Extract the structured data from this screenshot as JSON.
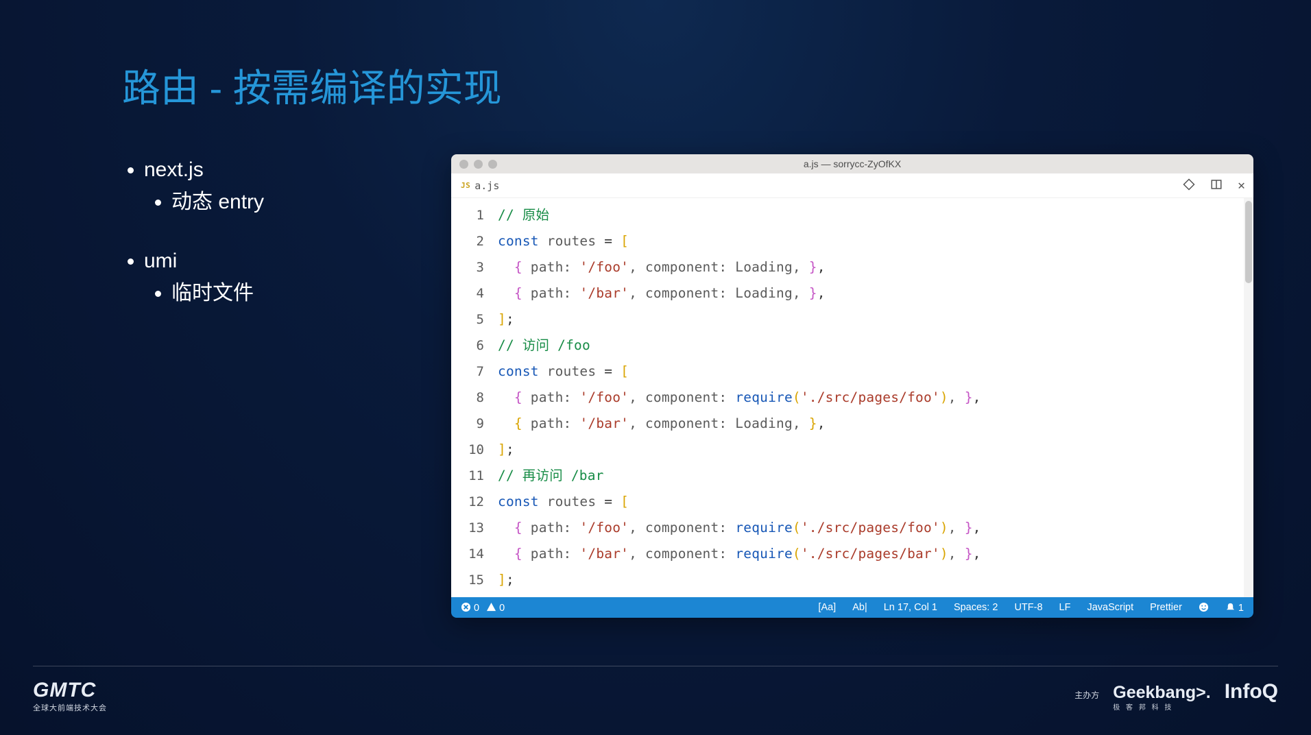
{
  "title": "路由 - 按需编译的实现",
  "bullets": {
    "items": [
      {
        "label": "next.js",
        "children": [
          {
            "label": "动态 entry"
          }
        ]
      },
      {
        "label": "umi",
        "children": [
          {
            "label": "临时文件"
          }
        ]
      }
    ]
  },
  "editor": {
    "window_title": "a.js — sorrycc-ZyOfKX",
    "tab": {
      "badge": "JS",
      "filename": "a.js"
    },
    "icons": {
      "git": "git-compare-icon",
      "layout": "layout-panels-icon",
      "close": "close-icon"
    },
    "code_lines": [
      [
        {
          "t": "// 原始",
          "c": "c-comment"
        }
      ],
      [
        {
          "t": "const ",
          "c": "c-kw"
        },
        {
          "t": "routes",
          "c": "c-var"
        },
        {
          "t": " = ",
          "c": "c-punc"
        },
        {
          "t": "[",
          "c": "c-brk-y"
        }
      ],
      [
        {
          "t": "  "
        },
        {
          "t": "{",
          "c": "c-brk-p"
        },
        {
          "t": " path: ",
          "c": "c-var"
        },
        {
          "t": "'/foo'",
          "c": "c-str"
        },
        {
          "t": ", component: Loading, ",
          "c": "c-var"
        },
        {
          "t": "}",
          "c": "c-brk-p"
        },
        {
          "t": ",",
          "c": "c-punc"
        }
      ],
      [
        {
          "t": "  "
        },
        {
          "t": "{",
          "c": "c-brk-p"
        },
        {
          "t": " path: ",
          "c": "c-var"
        },
        {
          "t": "'/bar'",
          "c": "c-str"
        },
        {
          "t": ", component: Loading, ",
          "c": "c-var"
        },
        {
          "t": "}",
          "c": "c-brk-p"
        },
        {
          "t": ",",
          "c": "c-punc"
        }
      ],
      [
        {
          "t": "]",
          "c": "c-brk-y"
        },
        {
          "t": ";",
          "c": "c-punc"
        }
      ],
      [
        {
          "t": "// 访问 /foo",
          "c": "c-comment"
        }
      ],
      [
        {
          "t": "const ",
          "c": "c-kw"
        },
        {
          "t": "routes",
          "c": "c-var"
        },
        {
          "t": " = ",
          "c": "c-punc"
        },
        {
          "t": "[",
          "c": "c-brk-y"
        }
      ],
      [
        {
          "t": "  "
        },
        {
          "t": "{",
          "c": "c-brk-p"
        },
        {
          "t": " path: ",
          "c": "c-var"
        },
        {
          "t": "'/foo'",
          "c": "c-str"
        },
        {
          "t": ", component: ",
          "c": "c-var"
        },
        {
          "t": "require",
          "c": "c-fn"
        },
        {
          "t": "(",
          "c": "c-brk-y"
        },
        {
          "t": "'./src/pages/foo'",
          "c": "c-str"
        },
        {
          "t": ")",
          "c": "c-brk-y"
        },
        {
          "t": ", ",
          "c": "c-var"
        },
        {
          "t": "}",
          "c": "c-brk-p"
        },
        {
          "t": ",",
          "c": "c-punc"
        }
      ],
      [
        {
          "t": "  "
        },
        {
          "t": "{",
          "c": "c-brk-y"
        },
        {
          "t": " path: ",
          "c": "c-var"
        },
        {
          "t": "'/bar'",
          "c": "c-str"
        },
        {
          "t": ", component: Loading, ",
          "c": "c-var"
        },
        {
          "t": "}",
          "c": "c-brk-y"
        },
        {
          "t": ",",
          "c": "c-punc"
        }
      ],
      [
        {
          "t": "]",
          "c": "c-brk-y"
        },
        {
          "t": ";",
          "c": "c-punc"
        }
      ],
      [
        {
          "t": "// 再访问 /bar",
          "c": "c-comment"
        }
      ],
      [
        {
          "t": "const ",
          "c": "c-kw"
        },
        {
          "t": "routes",
          "c": "c-var"
        },
        {
          "t": " = ",
          "c": "c-punc"
        },
        {
          "t": "[",
          "c": "c-brk-y"
        }
      ],
      [
        {
          "t": "  "
        },
        {
          "t": "{",
          "c": "c-brk-p"
        },
        {
          "t": " path: ",
          "c": "c-var"
        },
        {
          "t": "'/foo'",
          "c": "c-str"
        },
        {
          "t": ", component: ",
          "c": "c-var"
        },
        {
          "t": "require",
          "c": "c-fn"
        },
        {
          "t": "(",
          "c": "c-brk-y"
        },
        {
          "t": "'./src/pages/foo'",
          "c": "c-str"
        },
        {
          "t": ")",
          "c": "c-brk-y"
        },
        {
          "t": ", ",
          "c": "c-var"
        },
        {
          "t": "}",
          "c": "c-brk-p"
        },
        {
          "t": ",",
          "c": "c-punc"
        }
      ],
      [
        {
          "t": "  "
        },
        {
          "t": "{",
          "c": "c-brk-p"
        },
        {
          "t": " path: ",
          "c": "c-var"
        },
        {
          "t": "'/bar'",
          "c": "c-str"
        },
        {
          "t": ", component: ",
          "c": "c-var"
        },
        {
          "t": "require",
          "c": "c-fn"
        },
        {
          "t": "(",
          "c": "c-brk-y"
        },
        {
          "t": "'./src/pages/bar'",
          "c": "c-str"
        },
        {
          "t": ")",
          "c": "c-brk-y"
        },
        {
          "t": ", ",
          "c": "c-var"
        },
        {
          "t": "}",
          "c": "c-brk-p"
        },
        {
          "t": ",",
          "c": "c-punc"
        }
      ],
      [
        {
          "t": "]",
          "c": "c-brk-y"
        },
        {
          "t": ";",
          "c": "c-punc"
        }
      ]
    ],
    "statusbar": {
      "errors": "0",
      "warnings": "0",
      "items": [
        "[Aa]",
        "Ab|",
        "Ln 17, Col 1",
        "Spaces: 2",
        "UTF-8",
        "LF",
        "JavaScript",
        "Prettier"
      ],
      "bell_count": "1"
    }
  },
  "footer": {
    "gmtc": "GMTC",
    "gmtc_sub": "全球大前端技术大会",
    "zhuban": "主办方",
    "geek": "Geekbang>.",
    "geek_sub": "极 客 邦 科 技",
    "infoq": "InfoQ"
  }
}
